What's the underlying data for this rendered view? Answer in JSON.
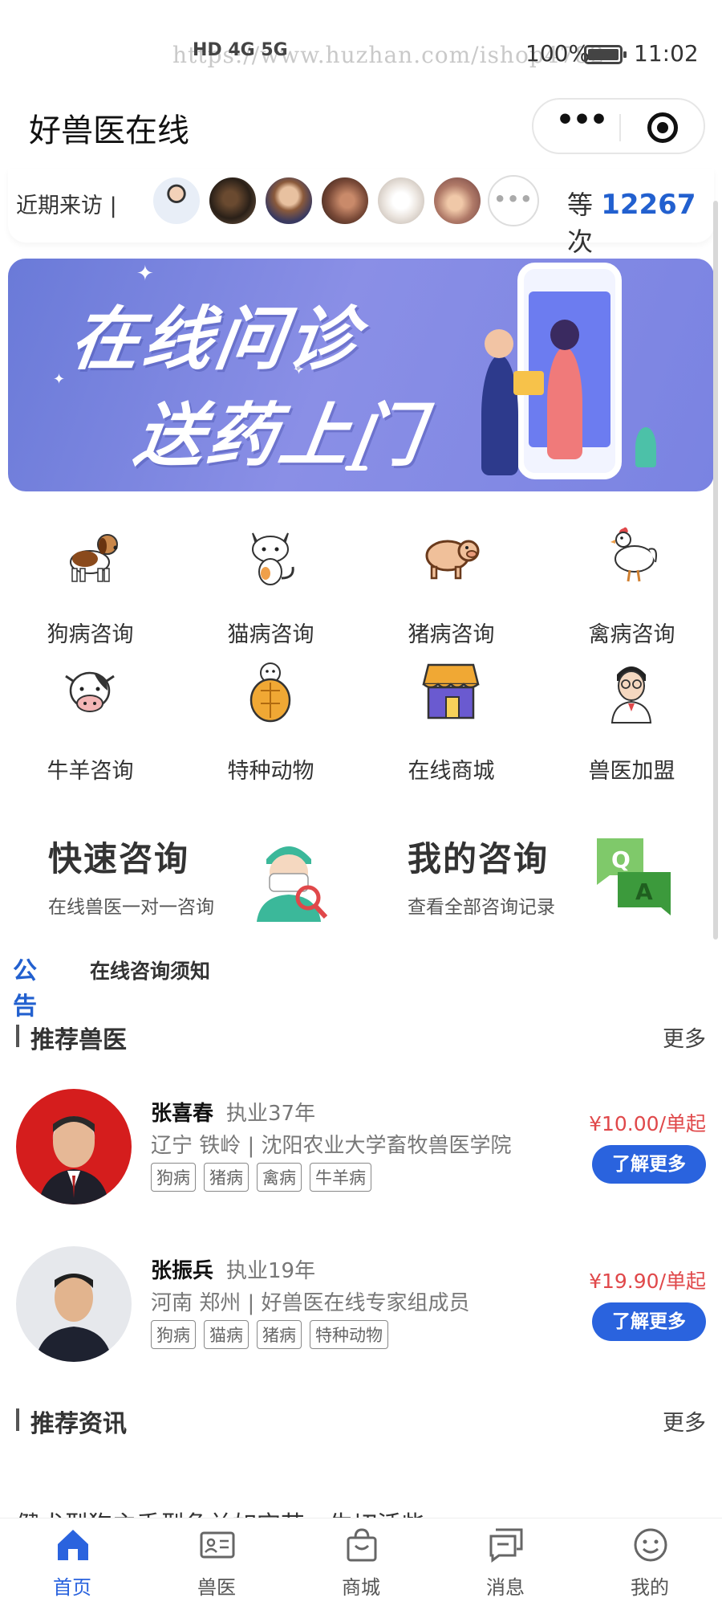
{
  "status_bar": {
    "url_watermark": "https://www.huzhan.com/ishop4782",
    "network": "HD 4G 5G",
    "battery": "100%",
    "time": "11:02"
  },
  "header": {
    "title": "好兽医在线"
  },
  "visitors": {
    "label": "近期来访",
    "count_prefix": "等",
    "count": "12267",
    "count_suffix": "次"
  },
  "banner": {
    "line1": "在线问诊",
    "line2": "送药上门"
  },
  "categories": [
    {
      "label": "狗病咨询",
      "icon": "dog-icon"
    },
    {
      "label": "猫病咨询",
      "icon": "cat-icon"
    },
    {
      "label": "猪病咨询",
      "icon": "pig-icon"
    },
    {
      "label": "禽病咨询",
      "icon": "chicken-icon"
    },
    {
      "label": "牛羊咨询",
      "icon": "cow-icon"
    },
    {
      "label": "特种动物",
      "icon": "turtle-icon"
    },
    {
      "label": "在线商城",
      "icon": "shop-icon"
    },
    {
      "label": "兽医加盟",
      "icon": "doctor-icon"
    }
  ],
  "quick": {
    "fast": {
      "title": "快速咨询",
      "sub": "在线兽医一对一咨询"
    },
    "mine": {
      "title": "我的咨询",
      "sub": "查看全部咨询记录"
    }
  },
  "notice": {
    "tag": "公告",
    "text": "在线咨询须知"
  },
  "recommend_vets": {
    "title": "推荐兽医",
    "more": "更多",
    "items": [
      {
        "name": "张喜春",
        "years": "执业37年",
        "desc": "辽宁 铁岭 | 沈阳农业大学畜牧兽医学院",
        "tags": [
          "狗病",
          "猪病",
          "禽病",
          "牛羊病"
        ],
        "price": "¥10.00/单起",
        "button": "了解更多"
      },
      {
        "name": "张振兵",
        "years": "执业19年",
        "desc": "河南 郑州 | 好兽医在线专家组成员",
        "tags": [
          "狗病",
          "猫病",
          "猪病",
          "特种动物"
        ],
        "price": "¥19.90/单起",
        "button": "了解更多"
      }
    ]
  },
  "recommend_news": {
    "title": "推荐资讯",
    "more": "更多",
    "peek": "健犬型狗主手型角兰如宝艺、生切活些"
  },
  "tabbar": [
    {
      "label": "首页",
      "icon": "home-icon",
      "active": true
    },
    {
      "label": "兽医",
      "icon": "id-card-icon",
      "active": false
    },
    {
      "label": "商城",
      "icon": "shopping-bag-icon",
      "active": false
    },
    {
      "label": "消息",
      "icon": "message-icon",
      "active": false
    },
    {
      "label": "我的",
      "icon": "smiley-icon",
      "active": false
    }
  ],
  "colors": {
    "accent": "#2a63de",
    "price": "#e0484a",
    "count": "#2260cf"
  }
}
